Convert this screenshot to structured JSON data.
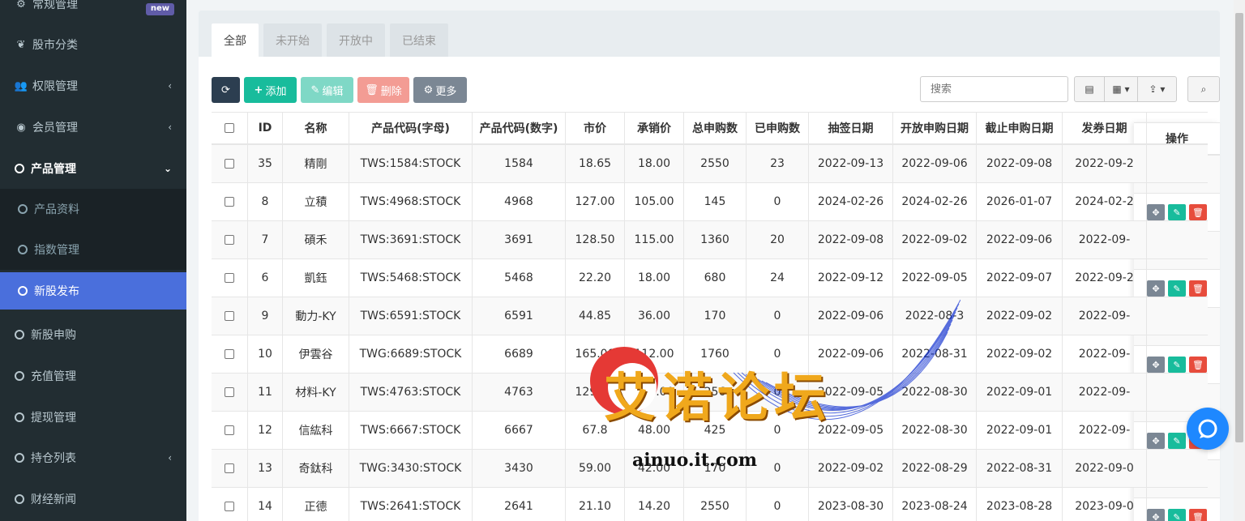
{
  "sidebar": {
    "items": [
      {
        "label": "常规管理",
        "icon": "gears-icon",
        "badge": "new"
      },
      {
        "label": "股市分类",
        "icon": "leaf-icon"
      },
      {
        "label": "权限管理",
        "icon": "group-icon"
      },
      {
        "label": "会员管理",
        "icon": "user-circle-icon"
      },
      {
        "label": "产品管理",
        "icon": "circle-icon"
      },
      {
        "label": "产品资料",
        "icon": "circle-icon"
      },
      {
        "label": "指数管理",
        "icon": "circle-icon"
      },
      {
        "label": "新股发布",
        "icon": "circle-icon"
      },
      {
        "label": "新股申购",
        "icon": "circle-icon"
      },
      {
        "label": "充值管理",
        "icon": "circle-icon"
      },
      {
        "label": "提现管理",
        "icon": "circle-icon"
      },
      {
        "label": "持仓列表",
        "icon": "circle-icon"
      },
      {
        "label": "财经新闻",
        "icon": "circle-icon"
      }
    ]
  },
  "tabs": [
    "全部",
    "未开始",
    "开放中",
    "已结束"
  ],
  "toolbar": {
    "refresh": "",
    "add": "添加",
    "edit": "编辑",
    "delete": "删除",
    "more": "更多",
    "search_placeholder": "搜索"
  },
  "colors": {
    "sidebar_bg": "#222d32",
    "active_menu": "#4a6fdc",
    "add_btn": "#18bc9c",
    "delete_btn": "#f39c94",
    "more_btn": "#7b8794",
    "refresh_btn": "#2c3e50"
  },
  "table": {
    "headers": [
      "ID",
      "名称",
      "产品代码(字母)",
      "产品代码(数字)",
      "市价",
      "承销价",
      "总申购数",
      "已申购数",
      "抽签日期",
      "开放申购日期",
      "截止申购日期",
      "发券日期"
    ],
    "ops_header": "操作",
    "rows": [
      [
        "35",
        "精剛",
        "TWS:1584:STOCK",
        "1584",
        "18.65",
        "18.00",
        "2550",
        "23",
        "2022-09-13",
        "2022-09-06",
        "2022-09-08",
        "2022-09-2"
      ],
      [
        "8",
        "立積",
        "TWS:4968:STOCK",
        "4968",
        "127.00",
        "105.00",
        "145",
        "0",
        "2024-02-26",
        "2024-02-26",
        "2026-01-07",
        "2024-02-2"
      ],
      [
        "7",
        "碩禾",
        "TWS:3691:STOCK",
        "3691",
        "128.50",
        "115.00",
        "1360",
        "20",
        "2022-09-08",
        "2022-09-02",
        "2022-09-06",
        "2022-09-"
      ],
      [
        "6",
        "凱鈺",
        "TWS:5468:STOCK",
        "5468",
        "22.20",
        "18.00",
        "680",
        "24",
        "2022-09-12",
        "2022-09-05",
        "2022-09-07",
        "2022-09-2"
      ],
      [
        "9",
        "動力-KY",
        "TWS:6591:STOCK",
        "6591",
        "44.85",
        "36.00",
        "170",
        "0",
        "2022-09-06",
        "2022-08-3",
        "2022-09-02",
        "2022-09-"
      ],
      [
        "10",
        "伊雲谷",
        "TWG:6689:STOCK",
        "6689",
        "165.00",
        "112.00",
        "1760",
        "0",
        "2022-09-06",
        "2022-08-31",
        "2022-09-02",
        "2022-09-"
      ],
      [
        "11",
        "材料-KY",
        "TWS:4763:STOCK",
        "4763",
        "129.00",
        "100.00",
        "256",
        "0",
        "2022-09-05",
        "2022-08-30",
        "2022-09-01",
        "2022-09-"
      ],
      [
        "12",
        "信紘科",
        "TWS:6667:STOCK",
        "6667",
        "67.8",
        "48.00",
        "425",
        "0",
        "2022-09-05",
        "2022-08-30",
        "2022-09-01",
        "2022-09-"
      ],
      [
        "13",
        "奇鈦科",
        "TWG:3430:STOCK",
        "3430",
        "59.00",
        "42.00",
        "170",
        "0",
        "2022-09-02",
        "2022-08-29",
        "2022-08-31",
        "2022-09-0"
      ],
      [
        "14",
        "正德",
        "TWS:2641:STOCK",
        "2641",
        "21.10",
        "14.20",
        "2550",
        "0",
        "2023-08-30",
        "2023-08-24",
        "2023-08-28",
        "2023-09-0"
      ]
    ]
  },
  "watermark": {
    "title": "艾诺论坛",
    "url": "ainuo.it.com"
  }
}
